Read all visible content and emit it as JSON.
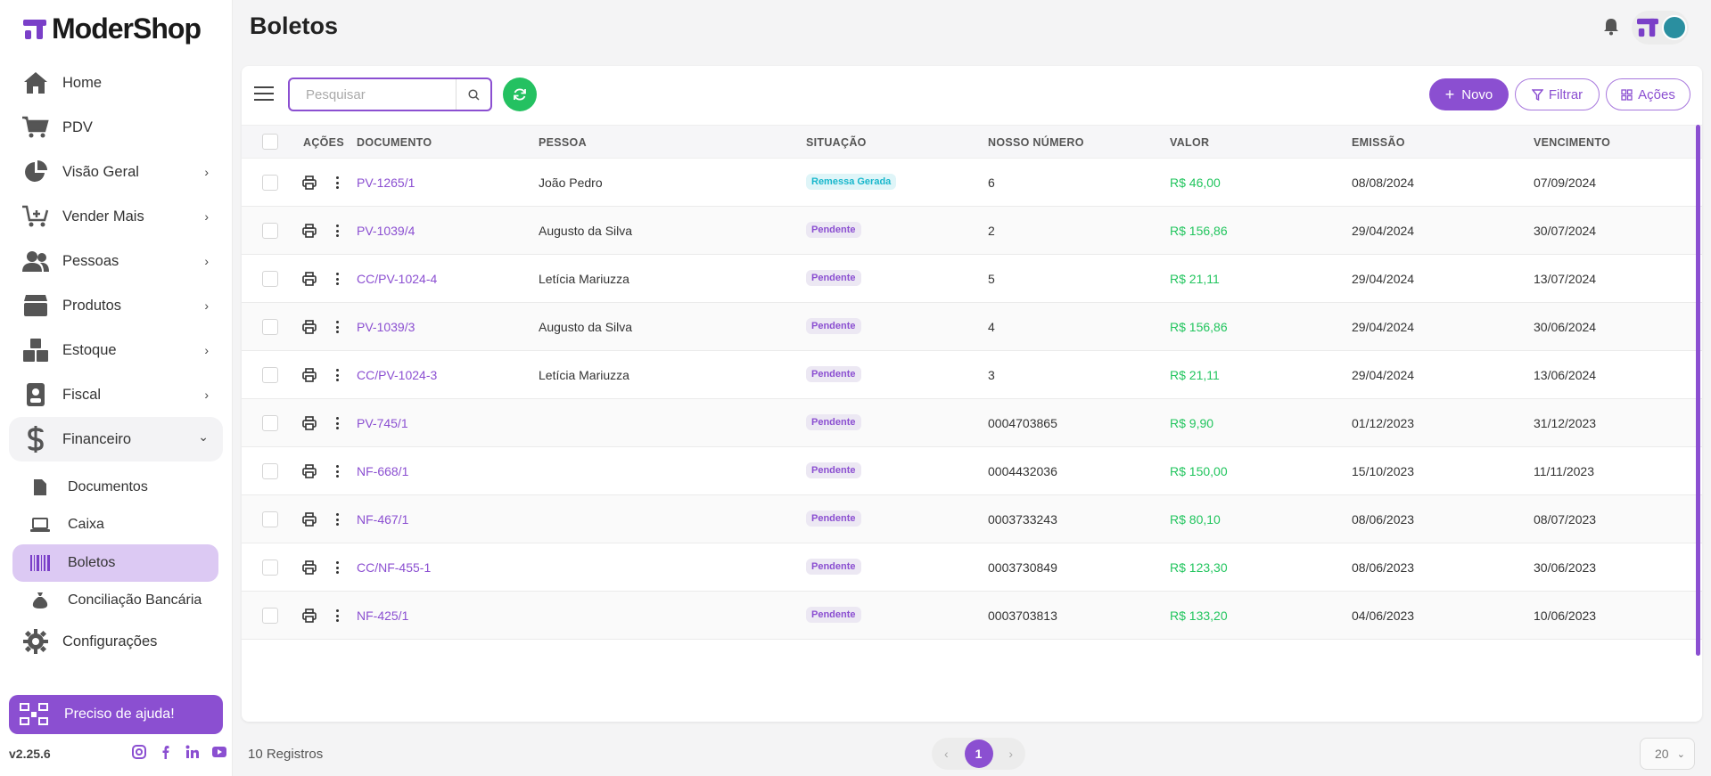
{
  "app": {
    "logo_text": "ModerShop",
    "version": "v2.25.6",
    "help_label": "Preciso de ajuda!"
  },
  "sidebar": {
    "items": [
      {
        "label": "Home",
        "icon": "home-icon"
      },
      {
        "label": "PDV",
        "icon": "cart-icon"
      },
      {
        "label": "Visão Geral",
        "icon": "pie-chart-icon"
      },
      {
        "label": "Vender Mais",
        "icon": "cart-plus-icon"
      },
      {
        "label": "Pessoas",
        "icon": "users-icon"
      },
      {
        "label": "Produtos",
        "icon": "box-icon"
      },
      {
        "label": "Estoque",
        "icon": "boxes-icon"
      },
      {
        "label": "Fiscal",
        "icon": "id-badge-icon"
      },
      {
        "label": "Financeiro",
        "icon": "dollar-icon"
      }
    ],
    "financeiro_sub": [
      {
        "label": "Documentos",
        "icon": "file-icon"
      },
      {
        "label": "Caixa",
        "icon": "laptop-icon"
      },
      {
        "label": "Boletos",
        "icon": "barcode-icon"
      },
      {
        "label": "Conciliação Bancária",
        "icon": "money-bag-icon"
      }
    ],
    "config_label": "Configurações"
  },
  "header": {
    "title": "Boletos"
  },
  "toolbar": {
    "search_placeholder": "Pesquisar",
    "novo_label": "Novo",
    "filtrar_label": "Filtrar",
    "acoes_label": "Ações"
  },
  "table": {
    "columns": [
      "AÇÕES",
      "DOCUMENTO",
      "PESSOA",
      "SITUAÇÃO",
      "NOSSO NÚMERO",
      "VALOR",
      "EMISSÃO",
      "VENCIMENTO"
    ],
    "rows": [
      {
        "documento": "PV-1265/1",
        "pessoa": "João Pedro",
        "situacao": "Remessa Gerada",
        "nosso_numero": "6",
        "valor": "R$ 46,00",
        "emissao": "08/08/2024",
        "vencimento": "07/09/2024"
      },
      {
        "documento": "PV-1039/4",
        "pessoa": "Augusto da Silva",
        "situacao": "Pendente",
        "nosso_numero": "2",
        "valor": "R$ 156,86",
        "emissao": "29/04/2024",
        "vencimento": "30/07/2024"
      },
      {
        "documento": "CC/PV-1024-4",
        "pessoa": "Letícia Mariuzza",
        "situacao": "Pendente",
        "nosso_numero": "5",
        "valor": "R$ 21,11",
        "emissao": "29/04/2024",
        "vencimento": "13/07/2024"
      },
      {
        "documento": "PV-1039/3",
        "pessoa": "Augusto da Silva",
        "situacao": "Pendente",
        "nosso_numero": "4",
        "valor": "R$ 156,86",
        "emissao": "29/04/2024",
        "vencimento": "30/06/2024"
      },
      {
        "documento": "CC/PV-1024-3",
        "pessoa": "Letícia Mariuzza",
        "situacao": "Pendente",
        "nosso_numero": "3",
        "valor": "R$ 21,11",
        "emissao": "29/04/2024",
        "vencimento": "13/06/2024"
      },
      {
        "documento": "PV-745/1",
        "pessoa": "",
        "situacao": "Pendente",
        "nosso_numero": "0004703865",
        "valor": "R$ 9,90",
        "emissao": "01/12/2023",
        "vencimento": "31/12/2023"
      },
      {
        "documento": "NF-668/1",
        "pessoa": "",
        "situacao": "Pendente",
        "nosso_numero": "0004432036",
        "valor": "R$ 150,00",
        "emissao": "15/10/2023",
        "vencimento": "11/11/2023"
      },
      {
        "documento": "NF-467/1",
        "pessoa": "",
        "situacao": "Pendente",
        "nosso_numero": "0003733243",
        "valor": "R$ 80,10",
        "emissao": "08/06/2023",
        "vencimento": "08/07/2023"
      },
      {
        "documento": "CC/NF-455-1",
        "pessoa": "",
        "situacao": "Pendente",
        "nosso_numero": "0003730849",
        "valor": "R$ 123,30",
        "emissao": "08/06/2023",
        "vencimento": "30/06/2023"
      },
      {
        "documento": "NF-425/1",
        "pessoa": "",
        "situacao": "Pendente",
        "nosso_numero": "0003703813",
        "valor": "R$ 133,20",
        "emissao": "04/06/2023",
        "vencimento": "10/06/2023"
      }
    ]
  },
  "footer": {
    "records": "10 Registros",
    "current_page": "1",
    "page_size": "20"
  },
  "colors": {
    "accent": "#8b4fd1",
    "success": "#22c55e",
    "refresh": "#24c161",
    "info": "#18b7cc"
  }
}
